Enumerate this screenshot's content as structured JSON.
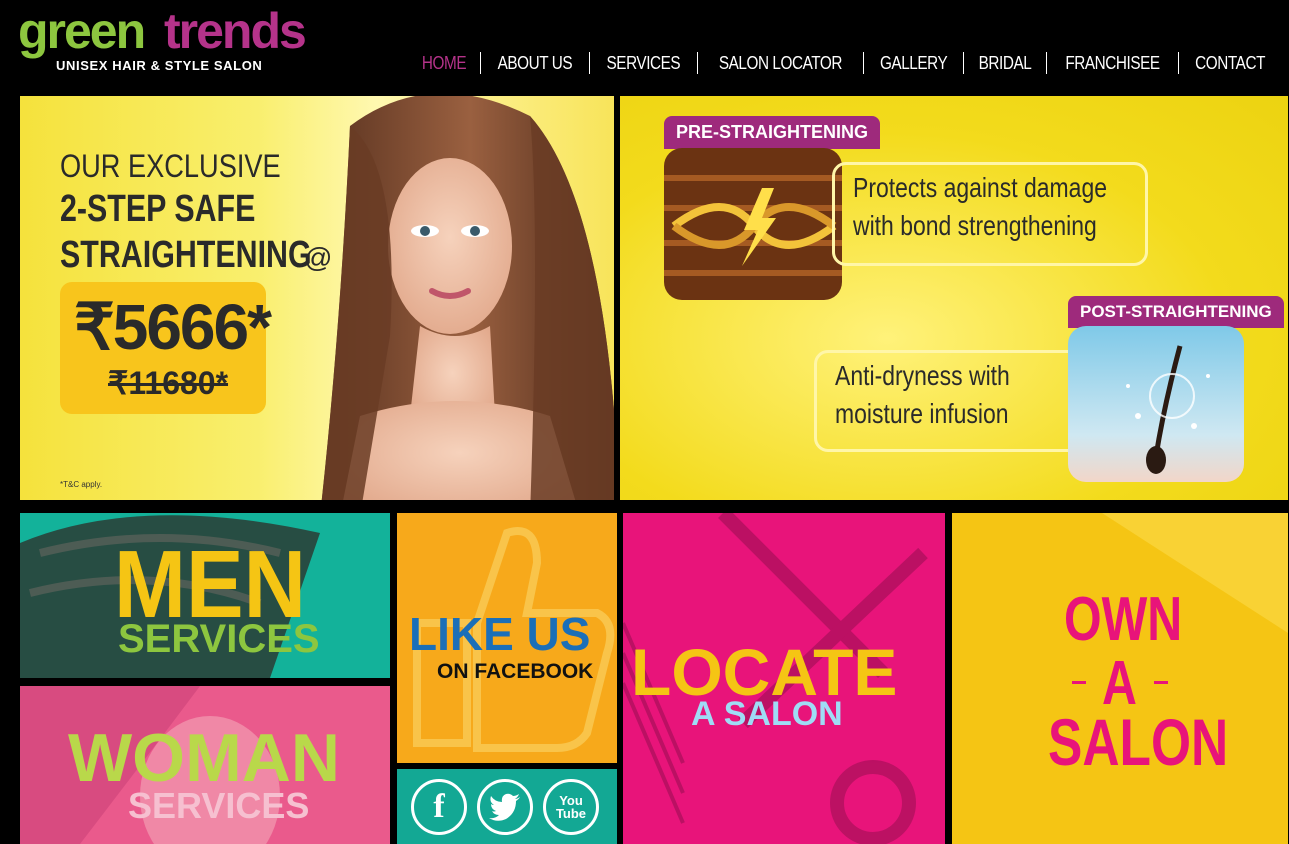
{
  "brand": {
    "name_part1": "green",
    "name_part2": "trends",
    "tagline": "UNISEX HAIR & STYLE SALON"
  },
  "nav": [
    {
      "label": "HOME",
      "active": true
    },
    {
      "label": "ABOUT US",
      "active": false
    },
    {
      "label": "SERVICES",
      "active": false
    },
    {
      "label": "SALON LOCATOR",
      "active": false
    },
    {
      "label": "GALLERY",
      "active": false
    },
    {
      "label": "BRIDAL",
      "active": false
    },
    {
      "label": "FRANCHISEE",
      "active": false
    },
    {
      "label": "CONTACT",
      "active": false
    }
  ],
  "banner1": {
    "line1": "OUR EXCLUSIVE",
    "line2": "2-STEP SAFE",
    "line3": "STRAIGHTENING",
    "at": "@",
    "price": "₹5666*",
    "old_price": "₹11680*",
    "terms": "*T&C apply."
  },
  "banner2": {
    "pre_label": "PRE-STRAIGHTENING",
    "pre_text_1": "Protects against damage",
    "pre_text_2": "with bond strengthening",
    "post_label": "POST-STRAIGHTENING",
    "post_text_1": "Anti-dryness with",
    "post_text_2": "moisture infusion"
  },
  "tiles": {
    "men_title": "MEN",
    "men_sub": "SERVICES",
    "woman_title": "WOMAN",
    "woman_sub": "SERVICES",
    "like_title": "LIKE US",
    "like_sub": "ON FACEBOOK",
    "locate_title": "LOCATE",
    "locate_sub": "A SALON",
    "own_1": "OWN",
    "own_2": "A",
    "own_3": "SALON"
  },
  "social": {
    "facebook": "f",
    "youtube_1": "You",
    "youtube_2": "Tube"
  },
  "colors": {
    "brand_green": "#8dc63f",
    "brand_magenta": "#b5338a",
    "teal": "#13b29a",
    "pink": "#e8147a",
    "yellow": "#f5c514",
    "orange": "#f7a91b"
  }
}
